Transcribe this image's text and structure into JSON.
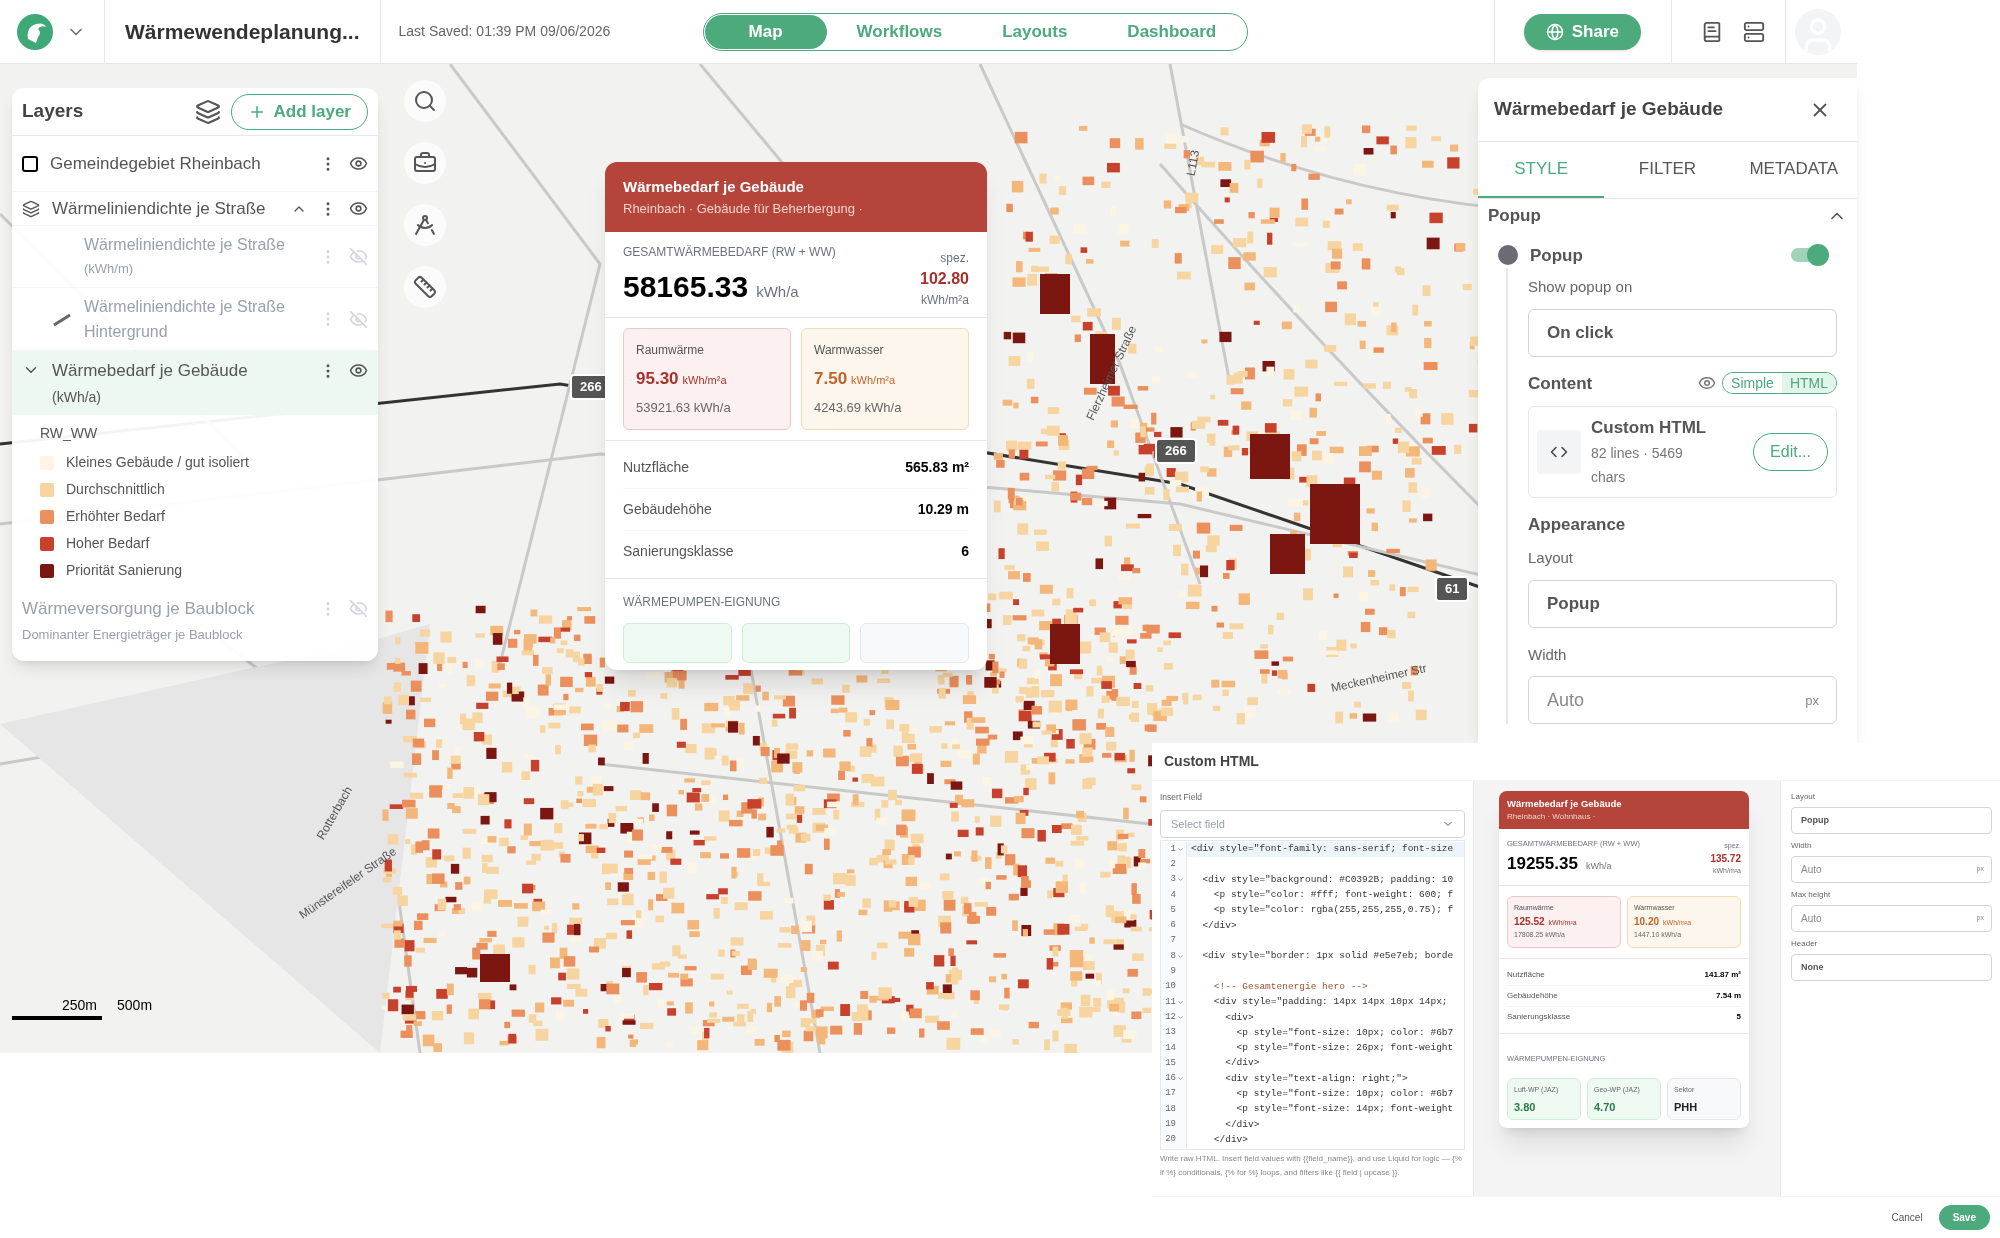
{
  "topbar": {
    "title": "Wärmewendeplanung...",
    "last_saved": "Last Saved: 01:39 PM 09/06/2026",
    "nav": [
      {
        "label": "Map",
        "selected": true
      },
      {
        "label": "Workflows",
        "selected": false
      },
      {
        "label": "Layouts",
        "selected": false
      },
      {
        "label": "Dashboard",
        "selected": false
      }
    ],
    "share": "Share"
  },
  "map": {
    "labels": [
      {
        "kind": "road",
        "text": "L113"
      },
      {
        "kind": "street",
        "text": "Flerzheimer Straße"
      },
      {
        "kind": "shield",
        "text": "266"
      },
      {
        "kind": "shield",
        "text": "266"
      },
      {
        "kind": "shield",
        "text": "61"
      },
      {
        "kind": "street",
        "text": "Meckenheimer Str"
      },
      {
        "kind": "street",
        "text": "Münstereifeler Straße"
      },
      {
        "kind": "street",
        "text": "Rotterbach"
      }
    ],
    "scale": [
      "250m",
      "500m"
    ]
  },
  "layers": {
    "title": "Layers",
    "add_button": "Add layer",
    "items": [
      {
        "kind": "checkbox",
        "name": "Gemeindegebiet Rheinbach",
        "checked": false,
        "visible": true
      },
      {
        "kind": "group",
        "name": "Wärmeliniendichte je Straße",
        "expanded": true,
        "visible": true,
        "children": [
          {
            "kind": "sub",
            "name": "Wärmeliniendichte je Straße",
            "unit": "(kWh/m)",
            "visible": false
          },
          {
            "kind": "line",
            "name": "Wärmeliniendichte je Straße Hintergrund",
            "visible": false
          }
        ]
      },
      {
        "kind": "layer",
        "name": "Wärmebedarf je Gebäude",
        "unit": "(kWh/a)",
        "expanded": true,
        "selected": true,
        "visible": true,
        "legend": {
          "field": "RW_WW",
          "classes": [
            {
              "label": "Kleines Gebäude / gut isoliert",
              "color": "#fdf5e4"
            },
            {
              "label": "Durchschnittlich",
              "color": "#f7d5a0"
            },
            {
              "label": "Erhöhter Bedarf",
              "color": "#eb8f5c"
            },
            {
              "label": "Hoher Bedarf",
              "color": "#c8412c"
            },
            {
              "label": "Priorität Sanierung",
              "color": "#7b1611"
            }
          ]
        }
      },
      {
        "kind": "layer",
        "name": "Wärmeversorgung je Baublock",
        "unit": "Dominanter Energieträger je Baublock",
        "expanded": false,
        "selected": false,
        "visible": false
      }
    ]
  },
  "popup": {
    "title": "Wärmebedarf je Gebäude",
    "subtitle": "Rheinbach · Gebäude für Beherbergung ·",
    "total_label": "GESAMTWÄRMEBEDARF (RW + WW)",
    "total_value": "58165.33",
    "total_unit": "kWh/a",
    "spec_label": "spez.",
    "spec_value": "102.80",
    "spec_unit": "kWh/m²a",
    "cards": [
      {
        "kind": "heat",
        "label": "Raumwärme",
        "value": "95.30",
        "unit": "kWh/m²a",
        "total": "53921.63 kWh/a"
      },
      {
        "kind": "water",
        "label": "Warmwasser",
        "value": "7.50",
        "unit": "kWh/m²a",
        "total": "4243.69 kWh/a"
      }
    ],
    "rows": [
      {
        "label": "Nutzfläche",
        "value": "565.83 m²"
      },
      {
        "label": "Gebäudehöhe",
        "value": "10.29 m"
      },
      {
        "label": "Sanierungsklasse",
        "value": "6"
      }
    ],
    "pump_title": "WÄRMEPUMPEN-EIGNUNG",
    "pump_tiles": [
      {
        "kind": "good"
      },
      {
        "kind": "good"
      },
      {
        "kind": "neutral"
      }
    ]
  },
  "panel": {
    "title": "Wärmebedarf je Gebäude",
    "tabs": [
      {
        "label": "STYLE",
        "selected": true
      },
      {
        "label": "FILTER",
        "selected": false
      },
      {
        "label": "METADATA",
        "selected": false
      }
    ],
    "section": {
      "title": "Popup",
      "expanded": true
    },
    "toggle": {
      "label": "Popup",
      "on": true
    },
    "show_on": {
      "label": "Show popup on",
      "value": "On click"
    },
    "content": {
      "label": "Content",
      "modes": [
        {
          "label": "Simple",
          "selected": false
        },
        {
          "label": "HTML",
          "selected": true
        }
      ],
      "card_title": "Custom HTML",
      "card_meta": "82 lines · 5469 chars",
      "edit": "Edit..."
    },
    "appearance": {
      "title": "Appearance",
      "layout_label": "Layout",
      "layout_value": "Popup",
      "width_label": "Width",
      "width_placeholder": "Auto",
      "width_unit": "px"
    }
  },
  "dialog": {
    "title": "Custom HTML",
    "insert_label": "Insert Field",
    "select_placeholder": "Select field",
    "code": [
      {
        "n": "1",
        "text": "<div style=\"font-family: sans-serif; font-size",
        "fold": true,
        "kind": "code"
      },
      {
        "n": "2",
        "fold": false
      },
      {
        "n": "3",
        "text": "  <div style=\"background: #C0392B; padding: 10",
        "fold": true,
        "kind": "code"
      },
      {
        "n": "4",
        "text": "    <p style=\"color: #fff; font-weight: 600; f",
        "fold": false,
        "kind": "code"
      },
      {
        "n": "5",
        "text": "    <p style=\"color: rgba(255,255,255,0.75); f",
        "fold": false,
        "kind": "code"
      },
      {
        "n": "6",
        "text": "  </div>",
        "fold": false,
        "kind": "code"
      },
      {
        "n": "7",
        "fold": false
      },
      {
        "n": "8",
        "text": "  <div style=\"border: 1px solid #e5e7eb; borde",
        "fold": true,
        "kind": "code"
      },
      {
        "n": "9",
        "fold": false
      },
      {
        "n": "10",
        "text": "    <!-- Gesamtenergie hero -->",
        "fold": false,
        "kind": "comment"
      },
      {
        "n": "11",
        "text": "    <div style=\"padding: 14px 14px 10px 14px;",
        "fold": true,
        "kind": "code"
      },
      {
        "n": "12",
        "text": "      <div>",
        "fold": true,
        "kind": "code"
      },
      {
        "n": "13",
        "text": "        <p style=\"font-size: 10px; color: #6b7",
        "fold": false,
        "kind": "code"
      },
      {
        "n": "14",
        "text": "        <p style=\"font-size: 26px; font-weight",
        "fold": false,
        "kind": "code"
      },
      {
        "n": "15",
        "text": "      </div>",
        "fold": false,
        "kind": "code"
      },
      {
        "n": "16",
        "text": "      <div style=\"text-align: right;\">",
        "fold": true,
        "kind": "code"
      },
      {
        "n": "17",
        "text": "        <p style=\"font-size: 10px; color: #6b7",
        "fold": false,
        "kind": "code"
      },
      {
        "n": "18",
        "text": "        <p style=\"font-size: 14px; font-weight",
        "fold": false,
        "kind": "code"
      },
      {
        "n": "19",
        "text": "      </div>",
        "fold": false,
        "kind": "code"
      },
      {
        "n": "20",
        "text": "    </div>",
        "fold": false,
        "kind": "code"
      }
    ],
    "help": "Write raw HTML. Insert field values with {{field_name}}, and use Liquid for logic — {% if %} conditionals, {% for %} loops, and filters like {{ field | upcase }}.",
    "preview": {
      "title": "Wärmebedarf je Gebäude",
      "subtitle": "Rheinbach · Wohnhaus ·",
      "total_label": "GESAMTWÄRMEBEDARF (RW + WW)",
      "total_value": "19255.35",
      "total_unit": "kWh/a",
      "spec_label": "spez.",
      "spec_value": "135.72",
      "spec_unit": "kWh/m²a",
      "cards": [
        {
          "kind": "heat",
          "label": "Raumwärme",
          "value": "125.52",
          "unit": "kWh/m²a",
          "total": "17808.25 kWh/a"
        },
        {
          "kind": "water",
          "label": "Warmwasser",
          "value": "10.20",
          "unit": "kWh/m²a",
          "total": "1447.10 kWh/a"
        }
      ],
      "rows": [
        {
          "label": "Nutzfläche",
          "value": "141.87 m²"
        },
        {
          "label": "Gebäudehöhe",
          "value": "7.54 m"
        },
        {
          "label": "Sanierungsklasse",
          "value": "5"
        }
      ],
      "pump_title": "WÄRMEPUMPEN-EIGNUNG",
      "pump_tiles": [
        {
          "kind": "good",
          "label": "Luft-WP (JAZ)",
          "value": "3.80"
        },
        {
          "kind": "good",
          "label": "Geo-WP (JAZ)",
          "value": "4.70"
        },
        {
          "kind": "neutral",
          "label": "Sektor",
          "value": "PHH"
        }
      ]
    },
    "settings": [
      {
        "label": "Layout",
        "value": "Popup"
      },
      {
        "label": "Width",
        "placeholder": "Auto",
        "unit": "px"
      },
      {
        "label": "Max height",
        "placeholder": "Auto",
        "unit": "px"
      },
      {
        "label": "Header",
        "value": "None"
      }
    ],
    "cancel": "Cancel",
    "save": "Save"
  }
}
